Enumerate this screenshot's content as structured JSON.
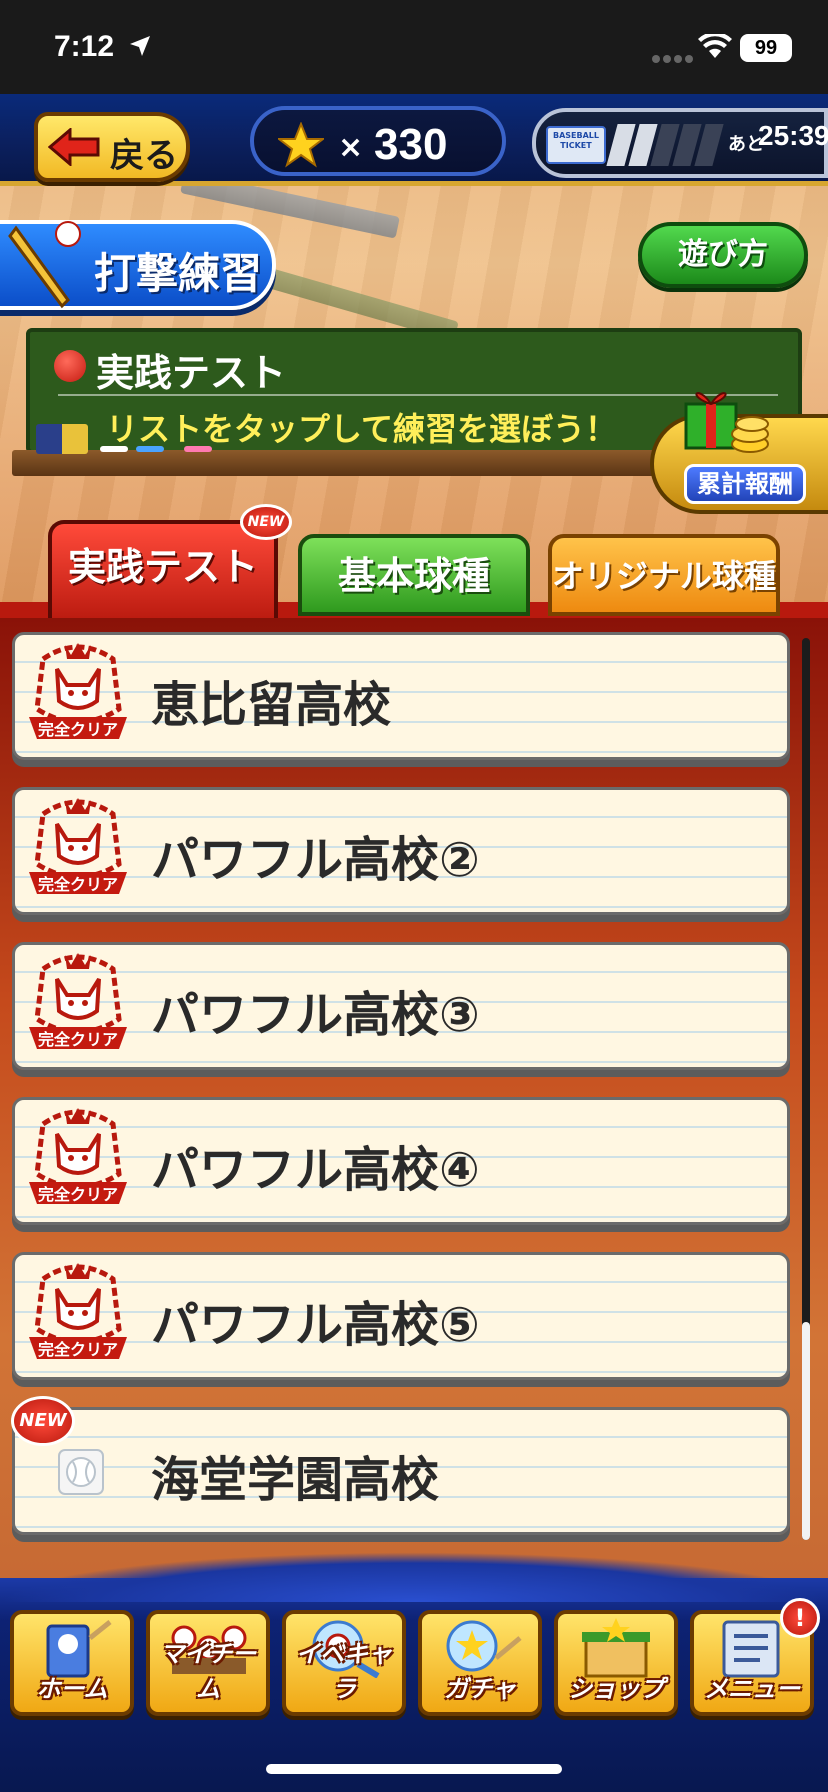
{
  "status": {
    "time": "7:12",
    "battery": "99"
  },
  "header": {
    "back_label": "戻る",
    "star_x": "×",
    "star_count": "330",
    "ticket_text": "BASEBALL TICKET",
    "ticket_timer_prefix": "あと",
    "ticket_timer": "25:39"
  },
  "mode": {
    "title": "打撃練習",
    "howto_label": "遊び方"
  },
  "board": {
    "title": "実践テスト",
    "subtitle": "リストをタップして練習を選ぼう！"
  },
  "reward": {
    "label": "累計報酬"
  },
  "tabs": [
    {
      "label": "実践テスト",
      "badge": "NEW",
      "active": true
    },
    {
      "label": "基本球種"
    },
    {
      "label": "オリジナル球種"
    }
  ],
  "rows": [
    {
      "label": "恵比留高校",
      "badge": "完全クリア"
    },
    {
      "label": "パワフル高校②",
      "badge": "完全クリア"
    },
    {
      "label": "パワフル高校③",
      "badge": "完全クリア"
    },
    {
      "label": "パワフル高校④",
      "badge": "完全クリア"
    },
    {
      "label": "パワフル高校⑤",
      "badge": "完全クリア"
    },
    {
      "label": "海堂学園高校",
      "new": "NEW"
    }
  ],
  "nav": [
    {
      "label": "ホーム",
      "icon": "home-icon"
    },
    {
      "label": "マイチーム",
      "icon": "team-icon"
    },
    {
      "label": "イベキャラ",
      "icon": "event-chara-icon"
    },
    {
      "label": "ガチャ",
      "icon": "gacha-icon"
    },
    {
      "label": "ショップ",
      "icon": "shop-icon"
    },
    {
      "label": "メニュー",
      "icon": "menu-icon",
      "alert": "!"
    }
  ]
}
